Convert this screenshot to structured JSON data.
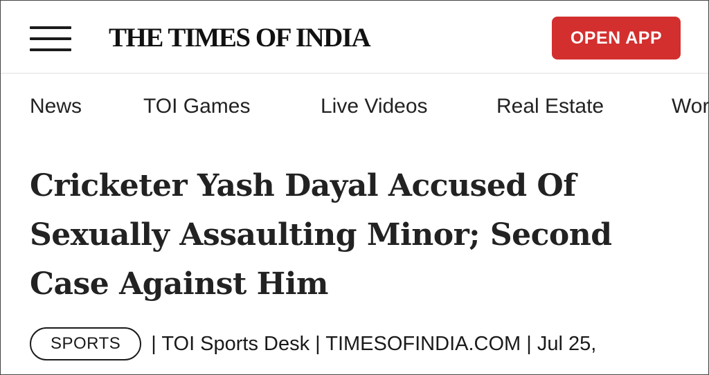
{
  "header": {
    "brand": "THE TIMES OF INDIA",
    "open_app_label": "OPEN APP",
    "menu_icon": "hamburger-menu-icon"
  },
  "nav": {
    "items": [
      {
        "label": "News"
      },
      {
        "label": "TOI Games"
      },
      {
        "label": "Live Videos"
      },
      {
        "label": "Real Estate"
      },
      {
        "label": "Wor"
      }
    ]
  },
  "article": {
    "headline": "Cricketer Yash Dayal Accused Of Sexually Assaulting Minor; Second Case Against Him",
    "category": "SPORTS",
    "byline": "| TOI Sports Desk | TIMESOFINDIA.COM | Jul 25,"
  },
  "colors": {
    "accent": "#d32f2f",
    "text": "#1a1a1a"
  }
}
